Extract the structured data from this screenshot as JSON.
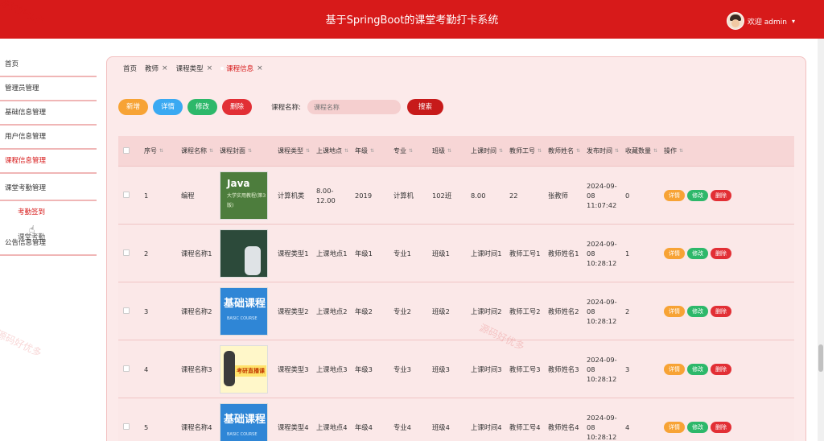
{
  "header": {
    "title": "基于SpringBoot的课堂考勤打卡系统",
    "welcome": "欢迎 admin"
  },
  "sidebar": {
    "items": [
      "首页",
      "管理员管理",
      "基础信息管理",
      "用户信息管理",
      "课程信息管理",
      "课堂考勤管理"
    ],
    "sub_items": [
      "考勤签到"
    ],
    "footer_item": "公告信息管理",
    "ghost_label": "课堂考勤"
  },
  "tabs": [
    {
      "label": "首页"
    },
    {
      "label": "教师"
    },
    {
      "label": "课程类型"
    },
    {
      "label": "课程信息"
    }
  ],
  "toolbar": {
    "add": "新增",
    "detail": "详情",
    "edit": "修改",
    "delete": "删除"
  },
  "search": {
    "label": "课程名称:",
    "placeholder": "课程名称",
    "button": "搜索"
  },
  "table": {
    "headers": [
      "序号",
      "课程名称",
      "课程封面",
      "课程类型",
      "上课地点",
      "年级",
      "专业",
      "班级",
      "上课时间",
      "教师工号",
      "教师姓名",
      "发布时间",
      "收藏数量",
      "操作"
    ],
    "rows": [
      {
        "idx": "1",
        "name": "编程",
        "cover": "java",
        "type": "计算机类",
        "place": "8.00-12.00",
        "grade": "2019",
        "major": "计算机",
        "cls": "102班",
        "time": "8.00",
        "tno": "22",
        "tname": "张教师",
        "pub": "2024-09-08 11:07:42",
        "fav": "0"
      },
      {
        "idx": "2",
        "name": "课程名称1",
        "cover": "board",
        "type": "课程类型1",
        "place": "上课地点1",
        "grade": "年级1",
        "major": "专业1",
        "cls": "班级1",
        "time": "上课时间1",
        "tno": "教师工号1",
        "tname": "教师姓名1",
        "pub": "2024-09-08 10:28:12",
        "fav": "1"
      },
      {
        "idx": "3",
        "name": "课程名称2",
        "cover": "blue",
        "type": "课程类型2",
        "place": "上课地点2",
        "grade": "年级2",
        "major": "专业2",
        "cls": "班级2",
        "time": "上课时间2",
        "tno": "教师工号2",
        "tname": "教师姓名2",
        "pub": "2024-09-08 10:28:12",
        "fav": "2"
      },
      {
        "idx": "4",
        "name": "课程名称3",
        "cover": "live",
        "type": "课程类型3",
        "place": "上课地点3",
        "grade": "年级3",
        "major": "专业3",
        "cls": "班级3",
        "time": "上课时间3",
        "tno": "教师工号3",
        "tname": "教师姓名3",
        "pub": "2024-09-08 10:28:12",
        "fav": "3"
      },
      {
        "idx": "5",
        "name": "课程名称4",
        "cover": "blue",
        "type": "课程类型4",
        "place": "上课地点4",
        "grade": "年级4",
        "major": "专业4",
        "cls": "班级4",
        "time": "上课时间4",
        "tno": "教师工号4",
        "tname": "教师姓名4",
        "pub": "2024-09-08 10:28:12",
        "fav": "4"
      }
    ],
    "actions": {
      "detail": "详情",
      "edit": "修改",
      "delete": "删除"
    }
  },
  "covers": {
    "java": {
      "title": "Java",
      "subtitle": "大学实用教程(第3版)"
    },
    "board": {
      "title": ""
    },
    "blue": {
      "title": "基础课程",
      "subtitle": "BASIC COURSE"
    },
    "live": {
      "title": "考研直播课"
    }
  },
  "watermark": "源码好优多",
  "colors": {
    "brand": "#d71a1a",
    "add": "#f7a335",
    "detail": "#3aa9f2",
    "edit": "#2db86a",
    "delete": "#e22f35"
  }
}
